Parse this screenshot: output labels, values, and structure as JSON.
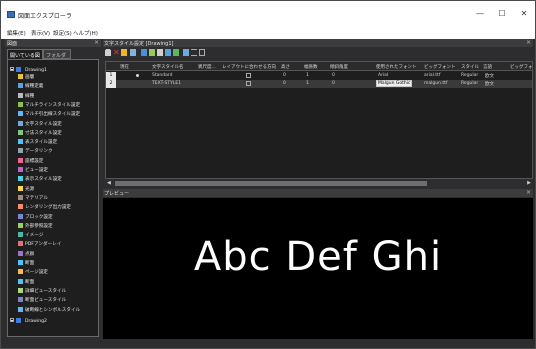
{
  "app": {
    "title": "図面エクスプローラ",
    "window_buttons": [
      "—",
      "☐",
      "✕"
    ]
  },
  "menu": [
    "編集(E)",
    "表示(V)",
    "設定(S)",
    "ヘルプ(H)"
  ],
  "left_panel": {
    "title": "図面",
    "close": "×",
    "tabs": [
      "開いている図面",
      "フォルダー"
    ],
    "tree": {
      "root": "Drawing1",
      "items": [
        "画層",
        "線種定義",
        "線種",
        "マルチラインスタイル設定",
        "マルチ引出線スタイル設定",
        "文字スタイル設定",
        "寸法スタイル設定",
        "表スタイル設定",
        "データリンク",
        "座標設定",
        "ビュー設定",
        "表示スタイル設定",
        "光源",
        "マテリアル",
        "レンダリング出力設定",
        "ブロック設定",
        "外部参照設定",
        "イメージ",
        "PDFアンダーレイ",
        "点群",
        "断面",
        "ページ設定",
        "断面",
        "詳細ビュースタイル",
        "断面ビュースタイル",
        "破断線とシンボルスタイル"
      ],
      "second_root": "Drawing2"
    }
  },
  "doc": {
    "tab_title": "文字スタイル設定 [Drawing1]",
    "close": "×"
  },
  "table": {
    "headers": [
      "現在",
      "文字スタイル名",
      "異尺度...",
      "レイアウトに合わせる方向",
      "高さ",
      "幅係数",
      "傾斜角度",
      "使用されたフォント",
      "ビッグフォント",
      "スタイル",
      "言語",
      "ビッグフォ"
    ],
    "rows": [
      {
        "num": "1",
        "current": true,
        "name": "Standard",
        "height": "0",
        "width": "1",
        "oblique": "0",
        "font": "Arial",
        "bigfont": "arial.ttf",
        "style": "Regular",
        "lang": "欧文"
      },
      {
        "num": "2",
        "current": false,
        "name": "TEXT-STYLE1",
        "height": "0",
        "width": "1",
        "oblique": "0",
        "font": "Malgun Gothic",
        "bigfont": "malgun.ttf",
        "style": "Regular",
        "lang": "欧文"
      }
    ]
  },
  "preview": {
    "title": "プレビュー",
    "close": "×",
    "sample_text": "Abc Def Ghi"
  },
  "scroll": {
    "left": "◀",
    "right": "▶"
  }
}
